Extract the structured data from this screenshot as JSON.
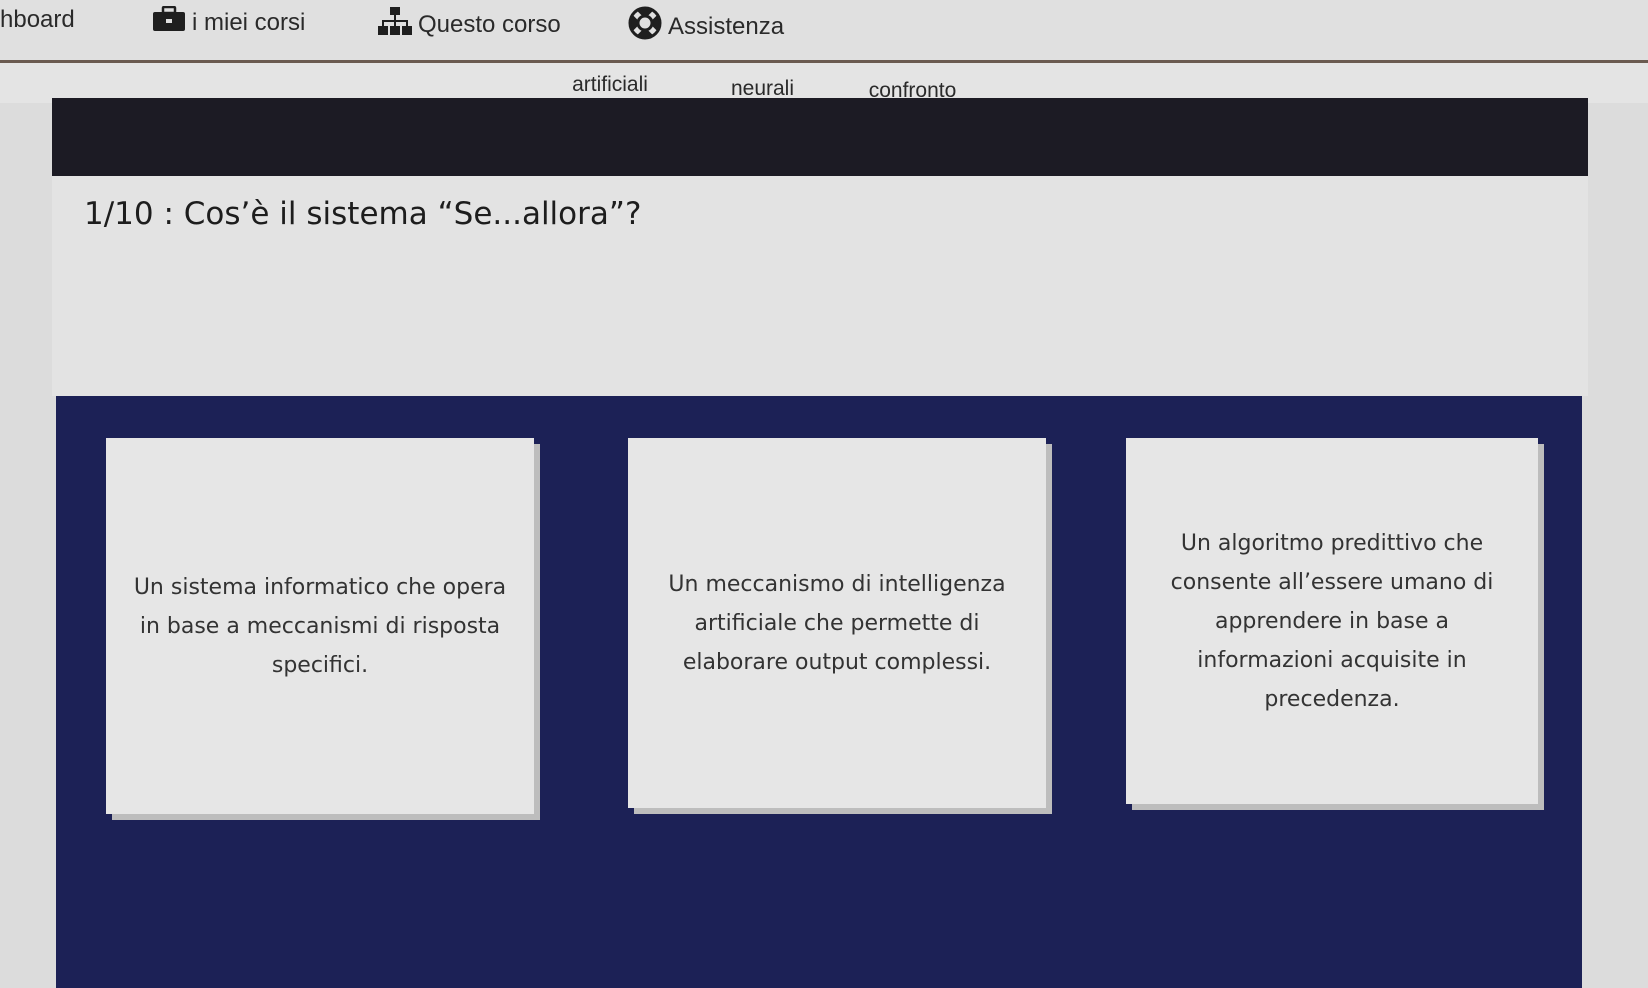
{
  "topnav": {
    "items": [
      {
        "label": "hboard",
        "icon": ""
      },
      {
        "label": "i miei corsi",
        "icon": "briefcase-icon"
      },
      {
        "label": "Questo corso",
        "icon": "sitemap-icon"
      },
      {
        "label": "Assistenza",
        "icon": "lifebuoy-icon"
      }
    ]
  },
  "tabs": {
    "items": [
      {
        "label": ""
      },
      {
        "label": ""
      },
      {
        "label": "artificiali"
      },
      {
        "label": "neurali"
      },
      {
        "label": "confronto"
      },
      {
        "label": ""
      },
      {
        "label": ""
      },
      {
        "label": ""
      }
    ],
    "active_color": "#d23a3a"
  },
  "question": {
    "title": "1/10 : Cos’è il sistema “Se...allora”?"
  },
  "answers": [
    {
      "text": "Un sistema informatico che opera in base a meccanismi di risposta specifici."
    },
    {
      "text": "Un meccanismo di intelligenza artificiale che permette di elaborare output complessi."
    },
    {
      "text": "Un algoritmo predittivo che consente all’essere umano di apprendere in base a informazioni acquisite in precedenza."
    }
  ],
  "colors": {
    "answers_panel": "#1c2156",
    "dark_band": "#1c1b24",
    "card": "#e6e6e6"
  }
}
